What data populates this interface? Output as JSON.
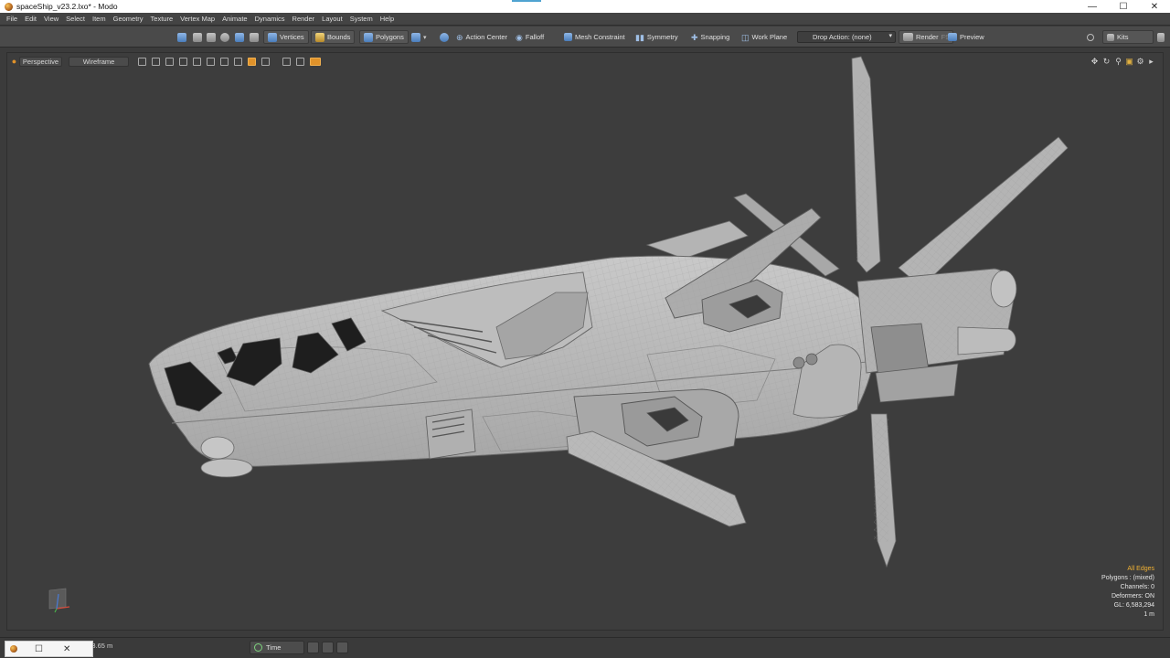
{
  "window": {
    "title": "spaceShip_v23.2.lxo* - Modo",
    "minimize_label": "—",
    "maximize_label": "☐",
    "close_label": "✕"
  },
  "menu": [
    "File",
    "Edit",
    "View",
    "Select",
    "Item",
    "Geometry",
    "Texture",
    "Vertex Map",
    "Animate",
    "Dynamics",
    "Render",
    "Layout",
    "System",
    "Help"
  ],
  "toolbar": {
    "vertices": "Vertices",
    "bounds": "Bounds",
    "polygons": "Polygons",
    "action_center": "Action Center",
    "falloff": "Falloff",
    "mesh_constraint": "Mesh Constraint",
    "symmetry": "Symmetry",
    "snapping": "Snapping",
    "work_plane": "Work Plane",
    "drop_action": "Drop Action: (none)",
    "render": "Render",
    "render_shortcut": "F9",
    "preview": "Preview",
    "kits": "Kits"
  },
  "viewport": {
    "view_mode": "Perspective",
    "shading": "Wireframe",
    "stats": {
      "selection": "All Edges",
      "polygons": "Polygons : (mixed)",
      "channels": "Channels: 0",
      "deformers": "Deformers: ON",
      "gl": "GL: 6,583,294",
      "scale": "1 m"
    }
  },
  "statusbar": {
    "distance": "n, 3.65 m",
    "time_label": "Time"
  },
  "colors": {
    "accent": "#f2b233",
    "viewport_bg": "#3d3d3d",
    "hull": "#b9b9b9",
    "window_glass": "#1e1e1e"
  },
  "icons": [
    "modo-app-icon",
    "vertices-icon",
    "bounds-icon",
    "polygons-icon",
    "action-center-icon",
    "falloff-icon",
    "mesh-constraint-icon",
    "symmetry-icon",
    "snapping-icon",
    "work-plane-icon",
    "render-icon",
    "preview-icon",
    "kits-icon",
    "search-icon",
    "time-icon"
  ]
}
